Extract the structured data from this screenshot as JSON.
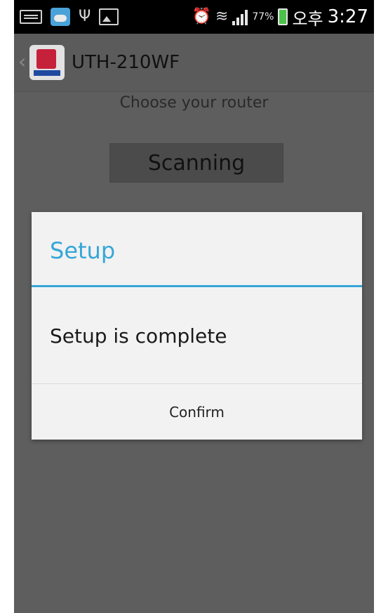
{
  "status_bar": {
    "battery_percent": "77%",
    "time": "3:27",
    "ampm": "오후",
    "icons": [
      "keyboard-icon",
      "weather-icon",
      "usb-icon",
      "image-icon",
      "alarm-icon",
      "wifi-icon",
      "signal-icon",
      "battery-charging-icon"
    ]
  },
  "app_bar": {
    "title": "UTH-210WF"
  },
  "main": {
    "subtitle": "Choose your router",
    "scan_button": "Scanning"
  },
  "dialog": {
    "title": "Setup",
    "message": "Setup is complete",
    "confirm_button": "Confirm",
    "accent_color": "#35a7d8"
  }
}
